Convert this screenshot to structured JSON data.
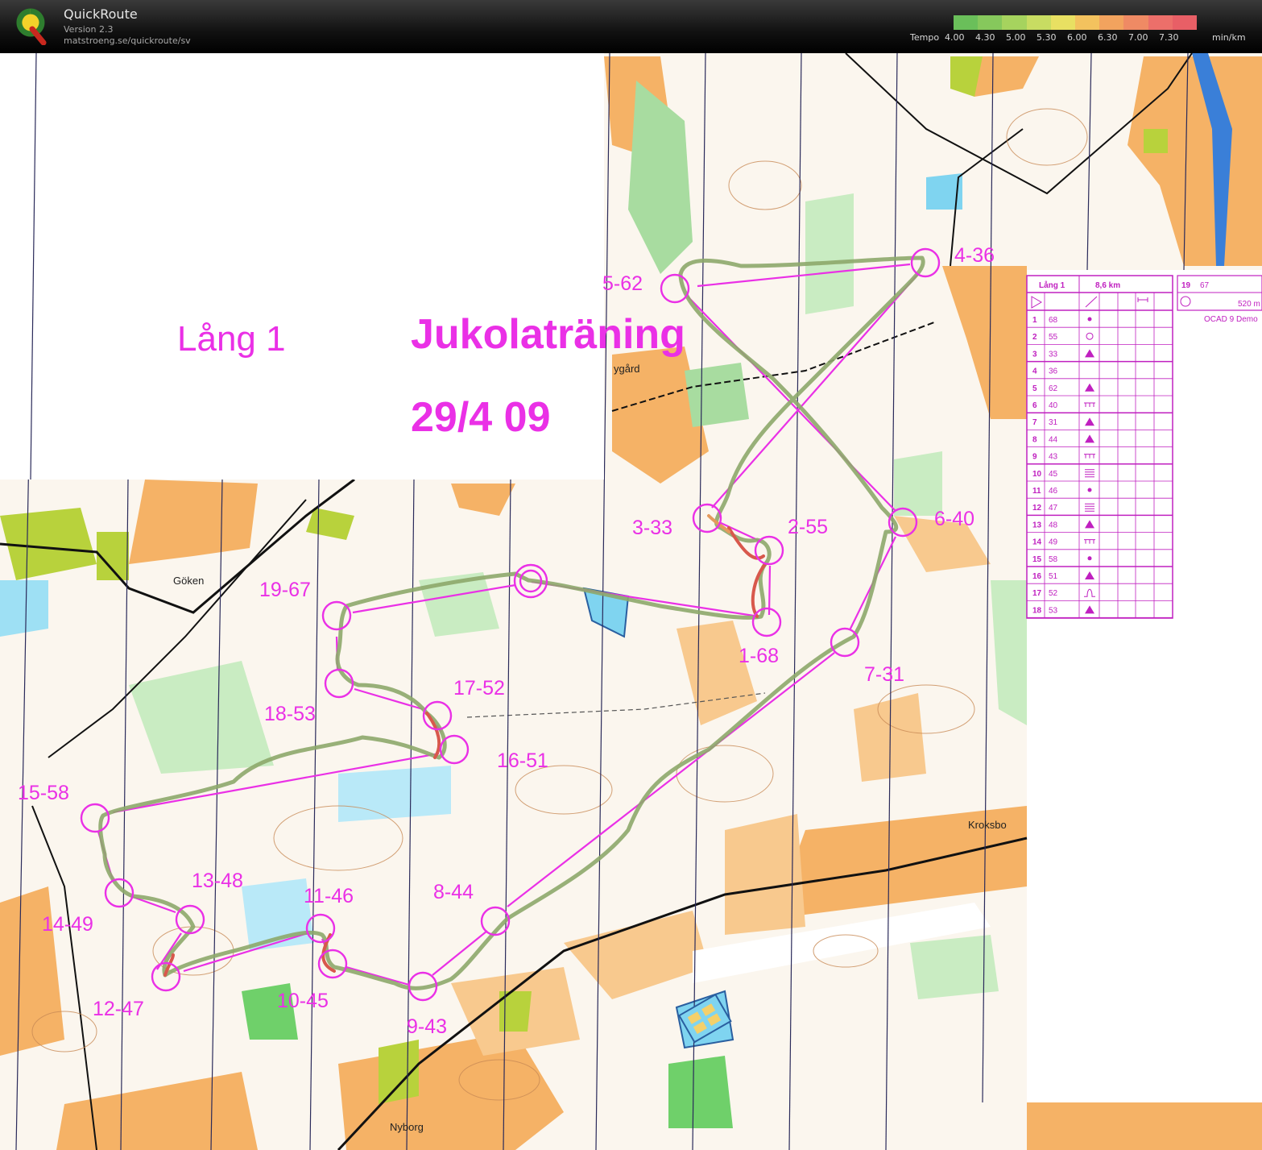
{
  "app": {
    "title": "QuickRoute",
    "version": "Version 2.3",
    "url": "matstroeng.se/quickroute/sv"
  },
  "tempo": {
    "label": "Tempo",
    "ticks": [
      "4.00",
      "4.30",
      "5.00",
      "5.30",
      "6.00",
      "6.30",
      "7.00",
      "7.30"
    ],
    "unit": "min/km",
    "colors": [
      "#6abf5a",
      "#86c85c",
      "#a6d35e",
      "#c8dc62",
      "#e8e062",
      "#f3c25e",
      "#f2a35e",
      "#ef8a64",
      "#ec6f6a",
      "#e85f66"
    ]
  },
  "map_text": {
    "course_name": "Lång 1",
    "event_title": "Jukolaträning",
    "event_date": "29/4 09",
    "places": [
      "Göken",
      "Kroksbo",
      "Nyborg",
      "ygård"
    ]
  },
  "controls": [
    {
      "label": "1-68"
    },
    {
      "label": "2-55"
    },
    {
      "label": "3-33"
    },
    {
      "label": "4-36"
    },
    {
      "label": "5-62"
    },
    {
      "label": "6-40"
    },
    {
      "label": "7-31"
    },
    {
      "label": "8-44"
    },
    {
      "label": "9-43"
    },
    {
      "label": "10-45"
    },
    {
      "label": "11-46"
    },
    {
      "label": "12-47"
    },
    {
      "label": "13-48"
    },
    {
      "label": "14-49"
    },
    {
      "label": "15-58"
    },
    {
      "label": "16-51"
    },
    {
      "label": "17-52"
    },
    {
      "label": "18-53"
    },
    {
      "label": "19-67"
    }
  ],
  "description_sheet": {
    "course": "Lång 1",
    "length": "8,6 km",
    "rows": [
      {
        "n": "1",
        "code": "68"
      },
      {
        "n": "2",
        "code": "55"
      },
      {
        "n": "3",
        "code": "33"
      },
      {
        "n": "4",
        "code": "36"
      },
      {
        "n": "5",
        "code": "62"
      },
      {
        "n": "6",
        "code": "40"
      },
      {
        "n": "7",
        "code": "31"
      },
      {
        "n": "8",
        "code": "44"
      },
      {
        "n": "9",
        "code": "43"
      },
      {
        "n": "10",
        "code": "45"
      },
      {
        "n": "11",
        "code": "46"
      },
      {
        "n": "12",
        "code": "47"
      },
      {
        "n": "13",
        "code": "48"
      },
      {
        "n": "14",
        "code": "49"
      },
      {
        "n": "15",
        "code": "58"
      },
      {
        "n": "16",
        "code": "51"
      },
      {
        "n": "17",
        "code": "52"
      },
      {
        "n": "18",
        "code": "53"
      }
    ],
    "extra": {
      "n": "19",
      "code": "67",
      "distance": "520 m",
      "footer": "OCAD 9 Demo"
    }
  }
}
